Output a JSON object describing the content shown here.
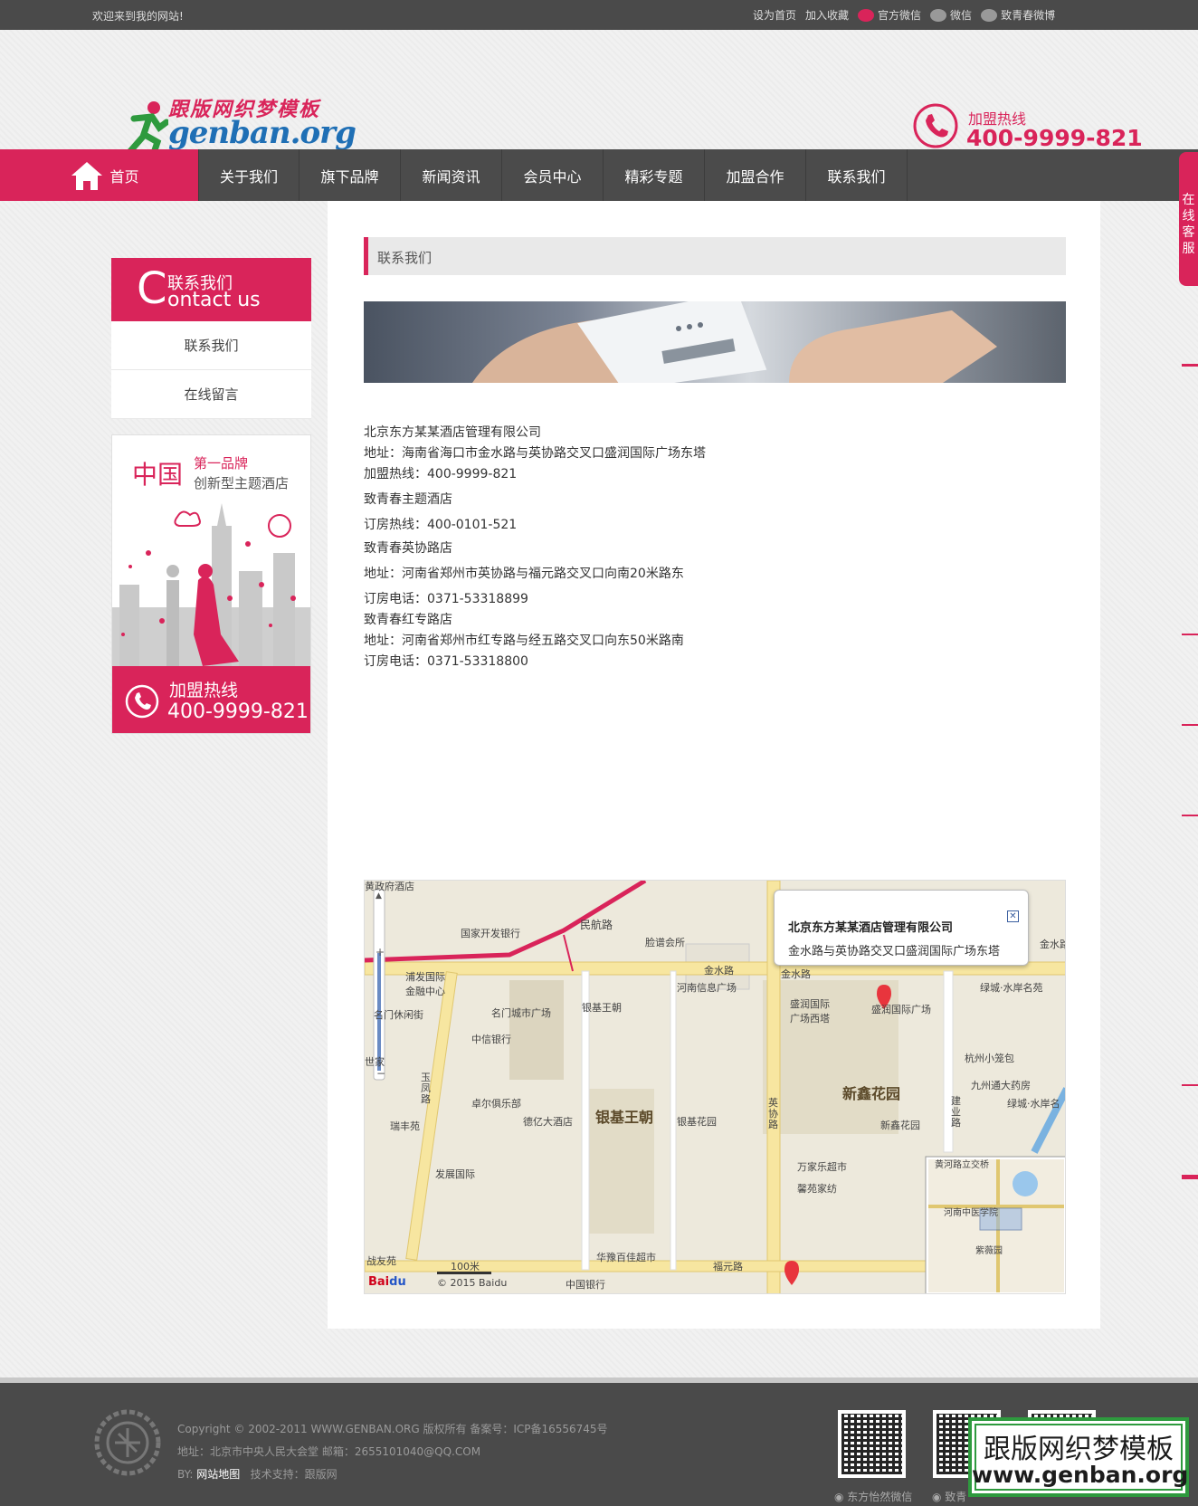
{
  "topbar": {
    "welcome": "欢迎来到我的网站!",
    "links": [
      "设为首页",
      "加入收藏",
      "官方微信",
      "微信",
      "致青春微博"
    ]
  },
  "header": {
    "logo_cn": "跟版网织梦模板",
    "logo_en": "genban.org",
    "hotline_label": "加盟热线",
    "hotline_number": "400-9999-821"
  },
  "nav": {
    "items": [
      "首页",
      "关于我们",
      "旗下品牌",
      "新闻资讯",
      "会员中心",
      "精彩专题",
      "加盟合作",
      "联系我们"
    ]
  },
  "side_float": {
    "text": "在线客服"
  },
  "sidebar": {
    "heading_cn": "联系我们",
    "heading_letter": "C",
    "heading_en": "ontact us",
    "items": [
      "联系我们",
      "在线留言"
    ]
  },
  "promo": {
    "title_big": "中国",
    "title_small_1": "第一品牌",
    "title_small_2": "创新型主题酒店",
    "hotline_label": "加盟热线",
    "hotline_number": "400-9999-821"
  },
  "main": {
    "breadcrumb": "联系我们",
    "info_lines": [
      "北京东方某某酒店管理有限公司",
      "地址：海南省海口市金水路与英协路交叉口盛润国际广场东塔",
      "加盟热线：400-9999-821",
      "致青春主题酒店",
      "订房热线：400-0101-521",
      "致青春英协路店",
      "地址：河南省郑州市英协路与福元路交叉口向南20米路东",
      "订房电话：0371-53318899",
      "致青春红专路店",
      "地址：河南省郑州市红专路与经五路交叉口向东50米路南",
      "订房电话：0371-53318800"
    ]
  },
  "map": {
    "popup_title": "北京东方某某酒店管理有限公司",
    "popup_address": "金水路与英协路交叉口盛润国际广场东塔",
    "labels": {
      "l1": "金水路",
      "l2": "金水路",
      "l3": "民航路",
      "l4": "国家开发银行",
      "l5": "脸谱会所",
      "l6": "浦发国际金融中心",
      "l7": "名门城市广场",
      "l8": "银基王朝",
      "l9": "河南信息广场",
      "l10": "盛润国际广场西塔",
      "l11": "盛润国际广场",
      "l12": "绿城·水岸名苑",
      "l13": "中信银行",
      "l14": "杭州小笼包",
      "l15": "九州通大药房",
      "l16": "新鑫花园",
      "l17": "绿城·水岸名",
      "l18": "卓尔俱乐部",
      "l19": "德亿大酒店",
      "l20": "银基王朝",
      "l21": "银基花园",
      "l22": "新鑫花园",
      "l23": "瑞丰苑",
      "l24": "英协路",
      "l25": "建业路",
      "l26": "万家乐超市",
      "l27": "馨苑家纺",
      "l28": "发展国际",
      "l29": "玉凤路",
      "l30": "华豫百佳超市",
      "l31": "福元路",
      "l32": "中国银行",
      "l33": "战友苑",
      "l34": "100米",
      "l35": "© 2015 Baidu",
      "l36": "黄河路立交桥",
      "l37": "河南中医学院",
      "l38": "紫薇园",
      "l39": "名门休闲街",
      "l40": "世家",
      "l41": "金水路",
      "l42": "黄政府酒店"
    }
  },
  "footer": {
    "copyright": "Copyright © 2002-2011 WWW.GENBAN.ORG 版权所有 备案号：ICP备16556745号",
    "address": "地址：北京市中央人民大会堂 邮箱：2655101040@QQ.COM",
    "by_label": "BY:",
    "sitemap": "网站地图",
    "support": "技术支持：跟版网",
    "qr1_label": "东方怡然微信",
    "qr2_label": "致青"
  },
  "watermark": {
    "line1": "跟版网织梦模板",
    "line2": "www.genban.org"
  },
  "colors": {
    "accent": "#d9245a",
    "dark": "#4b4b4b",
    "logo_blue": "#1f6fb5",
    "watermark_green": "#2e9a3e"
  }
}
